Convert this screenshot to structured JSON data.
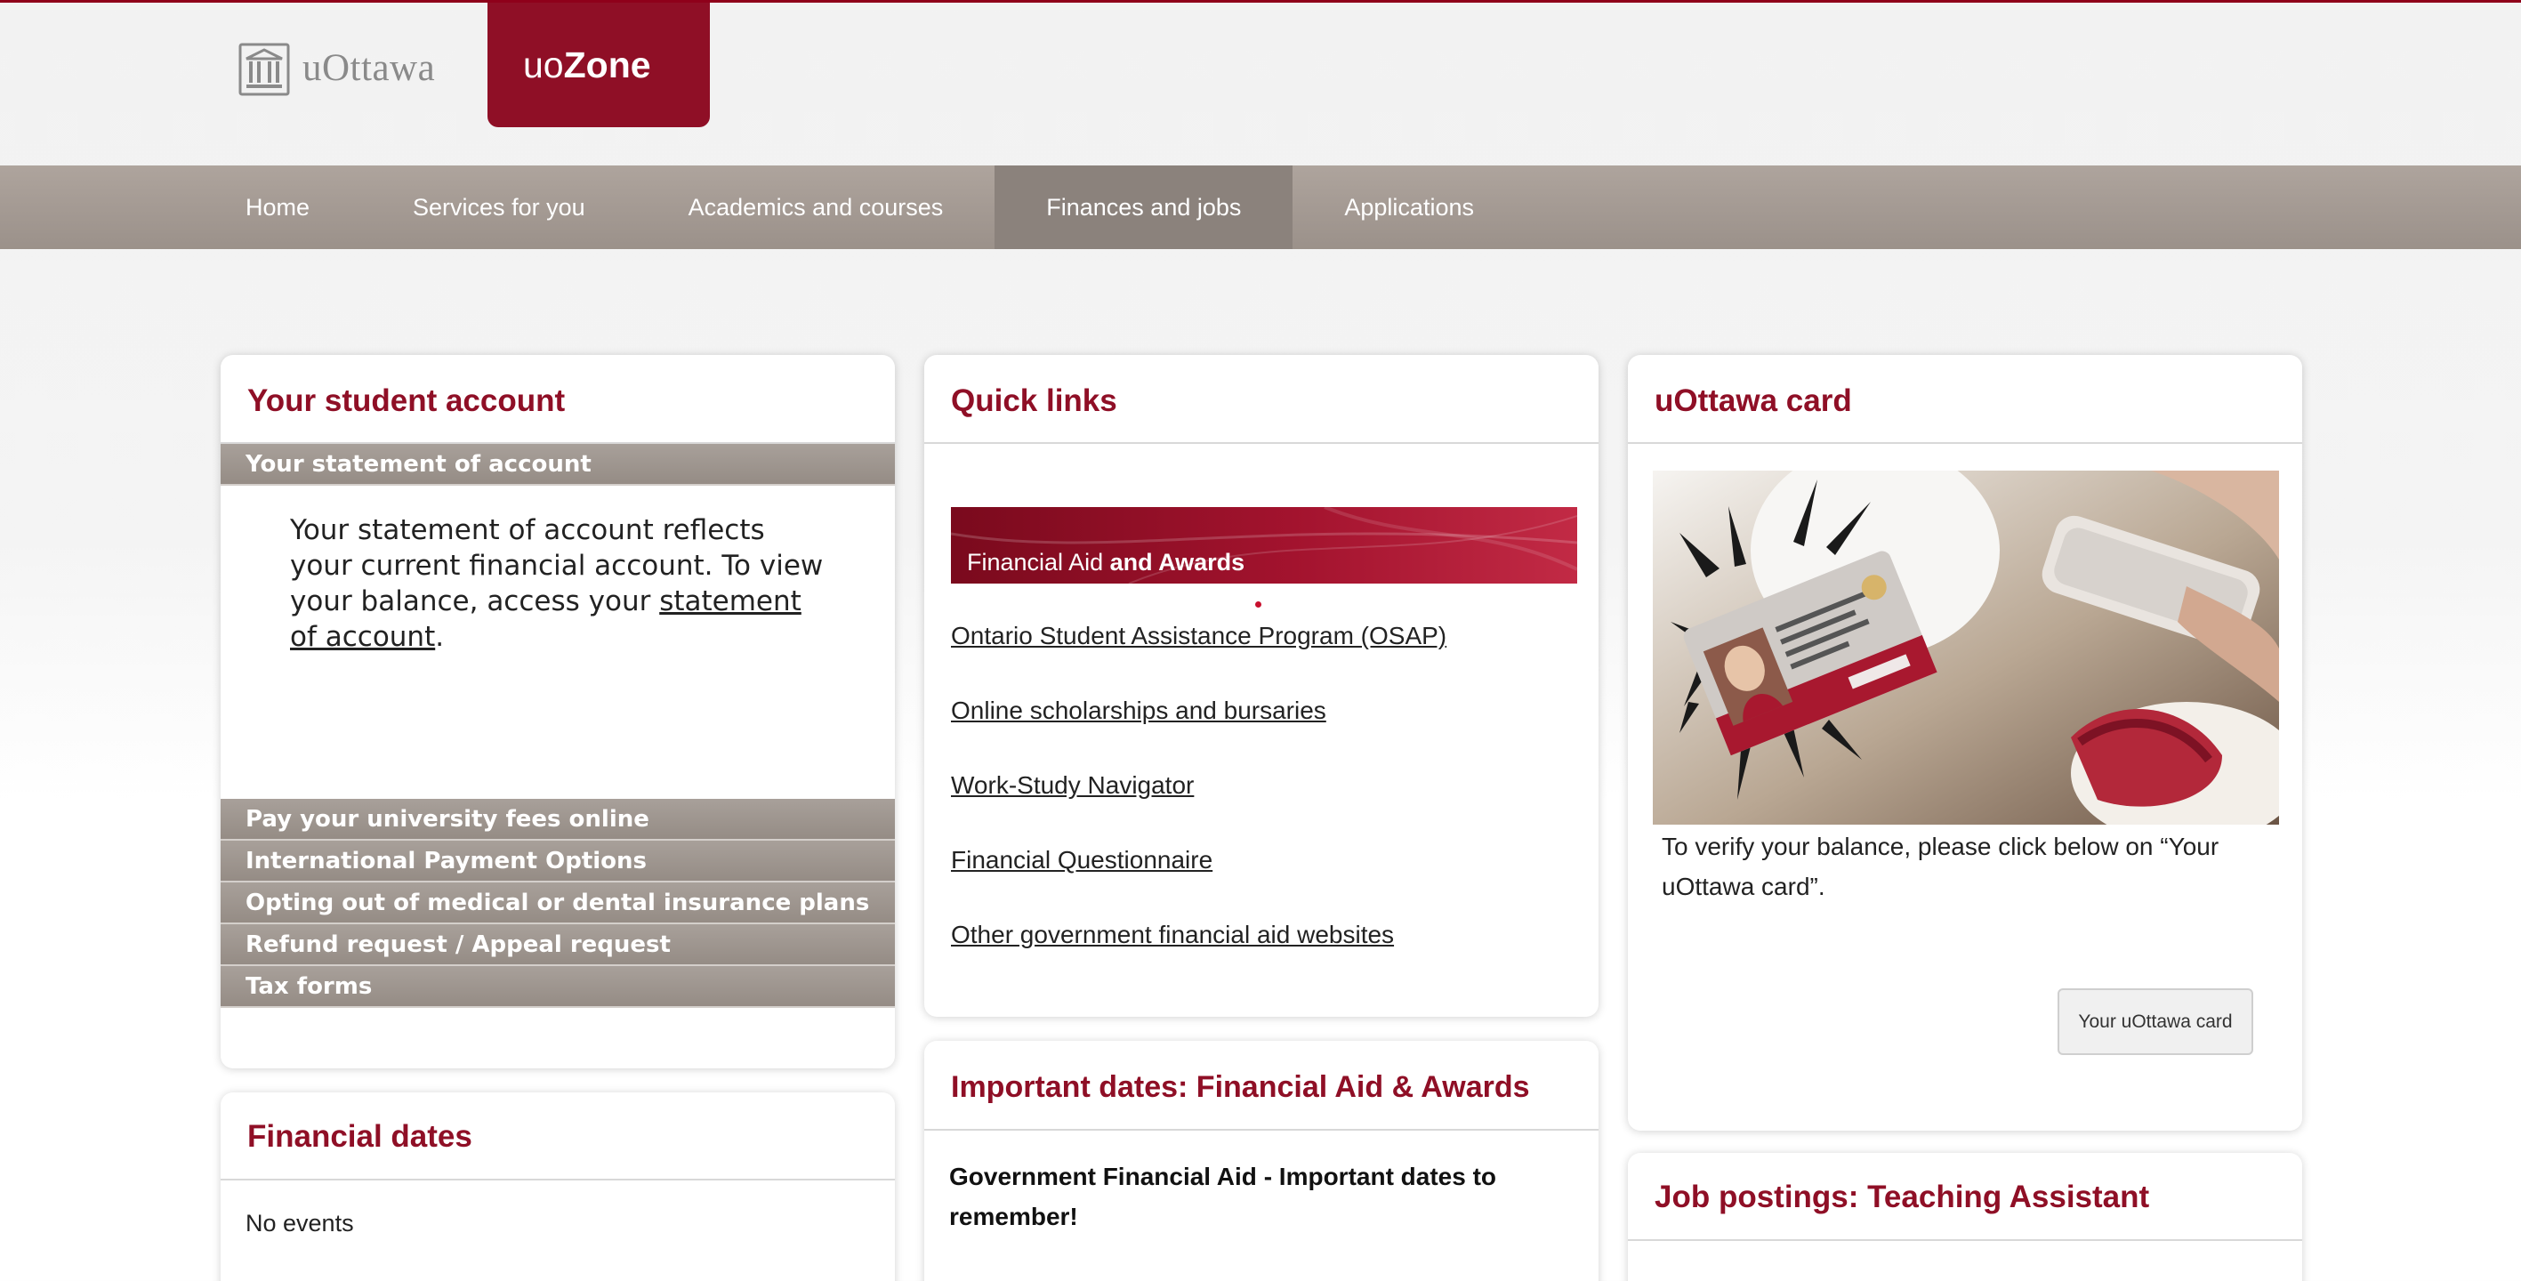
{
  "header": {
    "logo_text": "uOttawa",
    "uozone_prefix": "uo",
    "uozone_suffix": "Zone"
  },
  "nav": {
    "items": [
      {
        "label": "Home",
        "active": false
      },
      {
        "label": "Services for you",
        "active": false
      },
      {
        "label": "Academics and courses",
        "active": false
      },
      {
        "label": "Finances and jobs",
        "active": true
      },
      {
        "label": "Applications",
        "active": false
      }
    ]
  },
  "student_account": {
    "title": "Your student account",
    "statement_bar": "Your statement of account",
    "statement_text_before": "Your statement of account reflects your current financial account. To view your balance, access your ",
    "statement_link": "statement of account",
    "statement_text_after": ".",
    "bars": [
      "Pay your university fees online",
      "International Payment Options",
      "Opting out of medical or dental insurance plans",
      "Refund request / Appeal request",
      "Tax forms"
    ]
  },
  "financial_dates": {
    "title": "Financial dates",
    "empty_text": "No events"
  },
  "quick_links": {
    "title": "Quick links",
    "banner_text_1": "Financial Aid",
    "banner_text_2": "and Awards",
    "links": [
      "Ontario Student Assistance Program (OSAP)",
      "Online scholarships and bursaries",
      "Work-Study Navigator",
      "Financial Questionnaire",
      "Other government financial aid websites"
    ]
  },
  "important_dates": {
    "title": "Important dates: Financial Aid & Awards",
    "subtitle": "Government Financial Aid - Important dates to remember!"
  },
  "uottawa_card": {
    "title": "uOttawa card",
    "caption": "To verify your balance, please click below on “Your uOttawa card”.",
    "button_label": "Your uOttawa card"
  },
  "job_postings": {
    "title": "Job postings: Teaching Assistant"
  },
  "colors": {
    "brand": "#8f0f26",
    "nav_bg": "#a39a93",
    "nav_active": "#8b827c"
  }
}
